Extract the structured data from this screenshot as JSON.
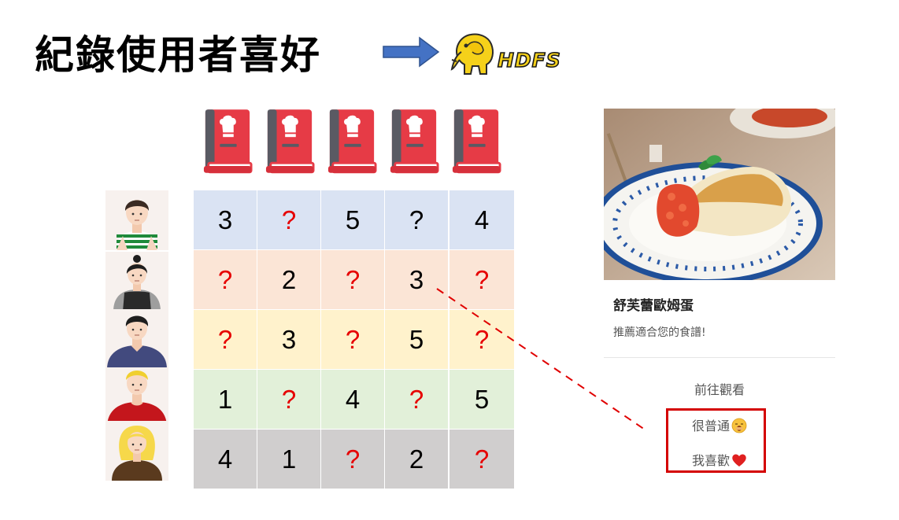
{
  "title": "紀錄使用者喜好",
  "logo": {
    "text": "HDFS",
    "icon": "hadoop-elephant-icon"
  },
  "books": {
    "icon": "cookbook-icon",
    "count": 5
  },
  "users": [
    {
      "icon": "user-avatar-striped-shirt"
    },
    {
      "icon": "user-avatar-bun-hair"
    },
    {
      "icon": "user-avatar-navy-sweater"
    },
    {
      "icon": "user-avatar-red-shirt"
    },
    {
      "icon": "user-avatar-blonde-hair"
    }
  ],
  "ratings": {
    "row_colors": [
      "#dae3f3",
      "#fbe5d6",
      "#fff2cc",
      "#e2f0d9",
      "#d0cece"
    ],
    "rows": [
      [
        "3",
        "?",
        "5",
        "?",
        "4"
      ],
      [
        "?",
        "2",
        "?",
        "3",
        "?"
      ],
      [
        "?",
        "3",
        "?",
        "5",
        "?"
      ],
      [
        "1",
        "?",
        "4",
        "?",
        "5"
      ],
      [
        "4",
        "1",
        "?",
        "2",
        "?"
      ]
    ],
    "unknown_color": "#e60000",
    "black_question_cell": [
      0,
      3
    ]
  },
  "card": {
    "image": "souffle-omelette-photo",
    "title": "舒芙蕾歐姆蛋",
    "subtitle": "推薦適合您的食譜!",
    "options": [
      {
        "label": "前往觀看",
        "emoji": ""
      },
      {
        "label": "很普通",
        "emoji": "yawning-face-icon"
      },
      {
        "label": "我喜歡",
        "emoji": "red-heart-icon"
      }
    ]
  },
  "accent_red": "#d40000",
  "arrow_color": "#4472c4"
}
